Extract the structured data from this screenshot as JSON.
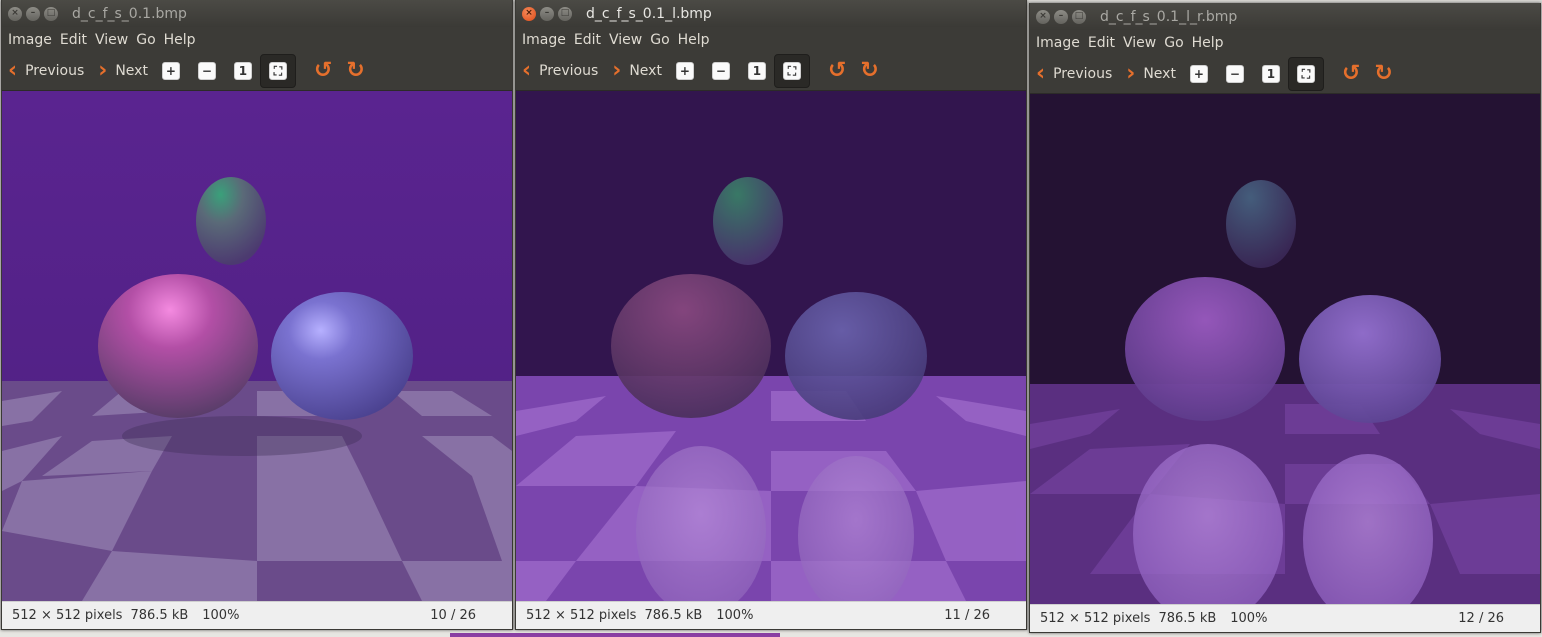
{
  "menu": [
    "Image",
    "Edit",
    "View",
    "Go",
    "Help"
  ],
  "toolbar": {
    "previous_label": "Previous",
    "next_label": "Next",
    "zoom_in_icon": "zoom-in-icon",
    "zoom_out_icon": "zoom-out-icon",
    "normal_size_icon": "normal-size-icon",
    "best_fit_icon": "best-fit-icon",
    "rotate_left_icon": "rotate-left-icon",
    "rotate_right_icon": "rotate-right-icon"
  },
  "windows": [
    {
      "title": "d_c_f_s_0.1.bmp",
      "active": false,
      "status": {
        "dimensions": "512 × 512 pixels",
        "filesize": "786.5 kB",
        "zoom": "100%",
        "position": "10 / 26"
      }
    },
    {
      "title": "d_c_f_s_0.1_l.bmp",
      "active": true,
      "status": {
        "dimensions": "512 × 512 pixels",
        "filesize": "786.5 kB",
        "zoom": "100%",
        "position": "11 / 26"
      }
    },
    {
      "title": "d_c_f_s_0.1_l_r.bmp",
      "active": false,
      "status": {
        "dimensions": "512 × 512 pixels",
        "filesize": "786.5 kB",
        "zoom": "100%",
        "position": "12 / 26"
      }
    }
  ],
  "colors": {
    "accent": "#e56f2c",
    "toolbar_bg": "#3c3b37",
    "title_bg": "#3b3a36"
  }
}
